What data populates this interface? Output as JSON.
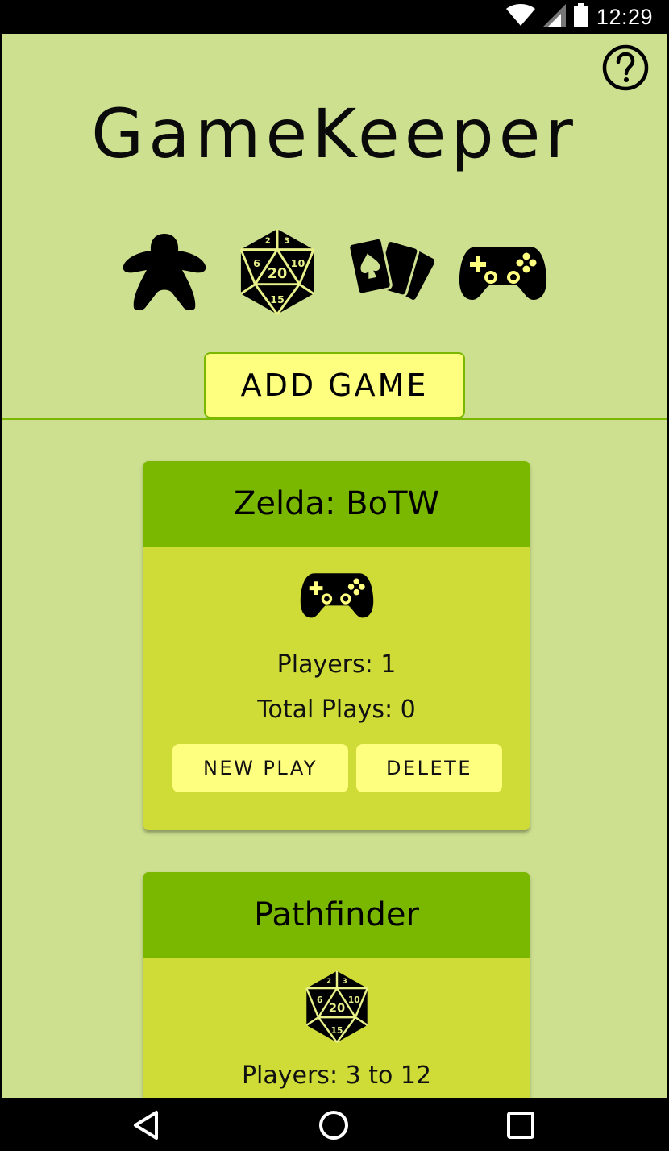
{
  "status_bar": {
    "time": "12:29",
    "icons": [
      "wifi-icon",
      "cell-signal-icon",
      "battery-icon"
    ]
  },
  "header": {
    "title": "GameKeeper",
    "help_icon": "help-circle-icon"
  },
  "categories": [
    {
      "name": "board-game",
      "icon": "meeple-icon"
    },
    {
      "name": "rpg",
      "icon": "d20-icon"
    },
    {
      "name": "card-game",
      "icon": "playing-cards-icon"
    },
    {
      "name": "video-game",
      "icon": "gamepad-icon"
    }
  ],
  "add_game_label": "ADD GAME",
  "games": [
    {
      "title": "Zelda: BoTW",
      "icon": "gamepad-icon",
      "players": "Players: 1",
      "total_plays": "Total Plays: 0",
      "new_play_label": "NEW PLAY",
      "delete_label": "DELETE"
    },
    {
      "title": "Pathfinder",
      "icon": "d20-icon",
      "players": "Players: 3 to 12"
    }
  ],
  "nav": {
    "back": "back-triangle-icon",
    "home": "home-circle-icon",
    "recents": "recents-square-icon"
  },
  "colors": {
    "background": "#cde08f",
    "header_green": "#7ab800",
    "card_body": "#cfdc38",
    "button_yellow": "#ffff7f"
  }
}
